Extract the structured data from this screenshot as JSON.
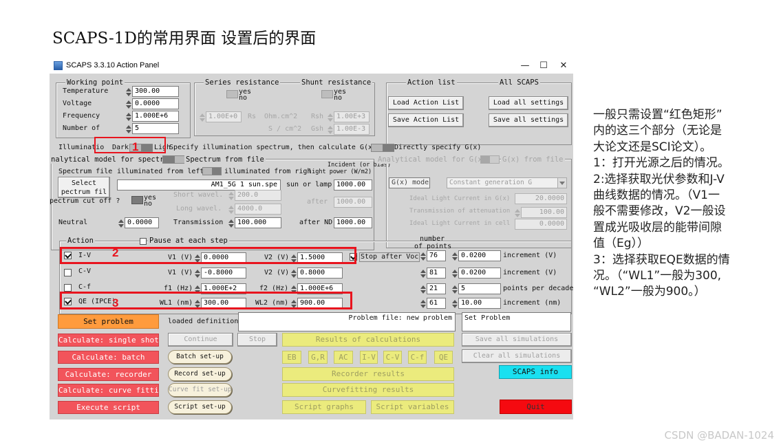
{
  "slide_title": "SCAPS-1D的常用界面 设置后的界面",
  "window": {
    "title": "SCAPS 3.3.10 Action Panel",
    "minimize": "—",
    "maximize": "☐",
    "close": "✕"
  },
  "working_point": {
    "legend": "Working point",
    "rows": [
      {
        "label": "Temperature",
        "value": "300.00"
      },
      {
        "label": "Voltage",
        "value": "0.0000"
      },
      {
        "label": "Frequency",
        "value": "1.000E+6"
      },
      {
        "label": "Number of",
        "value": "5"
      }
    ]
  },
  "series_resistance": {
    "legend": "Series resistance",
    "yes": "yes",
    "no": "no",
    "value": "1.00E+0",
    "rs_label": "Rs",
    "unit": "Ohm.cm^2"
  },
  "shunt_resistance": {
    "legend": "Shunt resistance",
    "yes": "yes",
    "no": "no",
    "rsh_label": "Rsh",
    "rsh_value": "1.00E+3",
    "gsh_unit": "S / cm^2",
    "gsh_label": "Gsh",
    "gsh_value": "1.00E-3"
  },
  "action_list": {
    "legend": "Action list",
    "load_action_list": "Load Action List",
    "save_action_list": "Save Action List"
  },
  "all_scaps": {
    "legend": "All SCAPS",
    "load_all": "Load all settings",
    "save_all": "Save all settings"
  },
  "illumination": {
    "label": "Illuminatio",
    "dark": "Dark",
    "light": "Ligh",
    "specify_text": "Specify illumination spectrum, then calculate G(x)",
    "direct_text": "Directly specify G(x)"
  },
  "analytical_left": {
    "legend": "nalytical model for spectrum",
    "spectrum_from_file": "Spectrum from file",
    "spectrum_file_label": "Spectrum file",
    "illuminated_from": "illuminated from left",
    "illuminated_right": "illuminated from righ",
    "select_line1": "Select",
    "select_line2": "pectrum fil",
    "spectrum_name": "AM1_5G 1 sun.spe",
    "incident_header_1": "Incident (or bias)",
    "incident_header_2": "light power (W/m2)",
    "sun_or_lamp_label": "sun or lamp",
    "sun_or_lamp_value": "1000.00",
    "cutoff_label": "pectrum cut off ?",
    "yes": "yes",
    "no": "no",
    "short_wavel_label": "Short wavel.",
    "short_wavel_value": "200.0",
    "long_wavel_label": "Long wavel.",
    "long_wavel_value": "4000.0",
    "after_label": "after",
    "after_value": "1000.00",
    "neutral_label": "Neutral",
    "neutral_value": "0.0000",
    "transmission_label": "Transmission",
    "transmission_value": "100.000",
    "after_nd_label": "after ND",
    "after_nd_value": "1000.00"
  },
  "analytical_right": {
    "legend": "Analytical model for G(x)",
    "gx_from_file": "G(x) from file",
    "gx_model_label": "G(x) model",
    "gx_model_value": "Constant generation G",
    "ideal_light_label": "Ideal Light Current in G(x)",
    "ideal_light_value": "20.0000",
    "transmission_label": "Transmission of attenuation",
    "transmission_value": "100.00",
    "ideal_cell_label": "Ideal Light Current in cell",
    "ideal_cell_value": "0.0000"
  },
  "action": {
    "legend": "Action",
    "pause_label": "Pause at each step",
    "num_points_header_1": "number",
    "num_points_header_2": "of points",
    "rows": [
      {
        "name": "I-V",
        "checked": true,
        "p1_label": "V1 (V)",
        "p1_value": "0.0000",
        "p2_label": "V2 (V)",
        "p2_value": "1.5000",
        "points": "76",
        "inc_value": "0.0200",
        "inc_label": "increment (V)"
      },
      {
        "name": "C-V",
        "checked": false,
        "p1_label": "V1 (V)",
        "p1_value": "-0.8000",
        "p2_label": "V2 (V)",
        "p2_value": "0.8000",
        "points": "81",
        "inc_value": "0.0200",
        "inc_label": "increment (V)"
      },
      {
        "name": "C-f",
        "checked": false,
        "p1_label": "f1 (Hz)",
        "p1_value": "1.000E+2",
        "p2_label": "f2 (Hz)",
        "p2_value": "1.000E+6",
        "points": "21",
        "inc_value": "5",
        "inc_label": "points per decade"
      },
      {
        "name": "QE (IPCE)",
        "checked": true,
        "p1_label": "WL1 (nm)",
        "p1_value": "300.00",
        "p2_label": "WL2 (nm)",
        "p2_value": "900.00",
        "points": "61",
        "inc_value": "10.00",
        "inc_label": "increment (nm)"
      }
    ],
    "stop_after_voc": "Stop after Voc"
  },
  "bottom": {
    "set_problem": "Set problem",
    "loaded_definition": "loaded definition file:",
    "problem_file": "Problem file: new problem",
    "set_problem_box": "Set Problem",
    "calc_single": "Calculate: single shot",
    "continue": "Continue",
    "stop": "Stop",
    "results": "Results of calculations",
    "save_all_sim": "Save all simulations",
    "calc_batch": "Calculate: batch",
    "batch_setup": "Batch set-up",
    "result_buttons": [
      "EB",
      "G,R",
      "AC",
      "I-V",
      "C-V",
      "C-f",
      "QE"
    ],
    "clear_all_sim": "Clear all simulations",
    "calc_recorder": "Calculate: recorder",
    "record_setup": "Record set-up",
    "recorder_results": "Recorder results",
    "scaps_info": "SCAPS info",
    "calc_curve": "Calculate: curve fitting",
    "curvefit_setup": "Curve fit set-up",
    "curvefit_results": "Curvefitting results",
    "execute_script": "Execute script",
    "script_setup": "Script set-up",
    "script_graphs": "Script graphs",
    "script_variables": "Script variables",
    "quit": "Quit"
  },
  "markers": [
    "1",
    "2",
    "3"
  ],
  "notes": {
    "lines": [
      "一般只需设置“红色矩形”",
      "内的这三个部分（无论是",
      "大论文还是SCI论文）。",
      "1：打开光源之后的情况。",
      "2:选择获取光伏参数和J-V",
      "曲线数据的情况。（V1一",
      "般不需要修改，V2一般设",
      "置成光吸收层的能带间隙",
      "值（Eg））",
      "3：选择获取EQE数据的情",
      "况。（“WL1”一般为300,",
      "“WL2”一般为900。）"
    ]
  },
  "watermark": "CSDN @BADAN-1024"
}
